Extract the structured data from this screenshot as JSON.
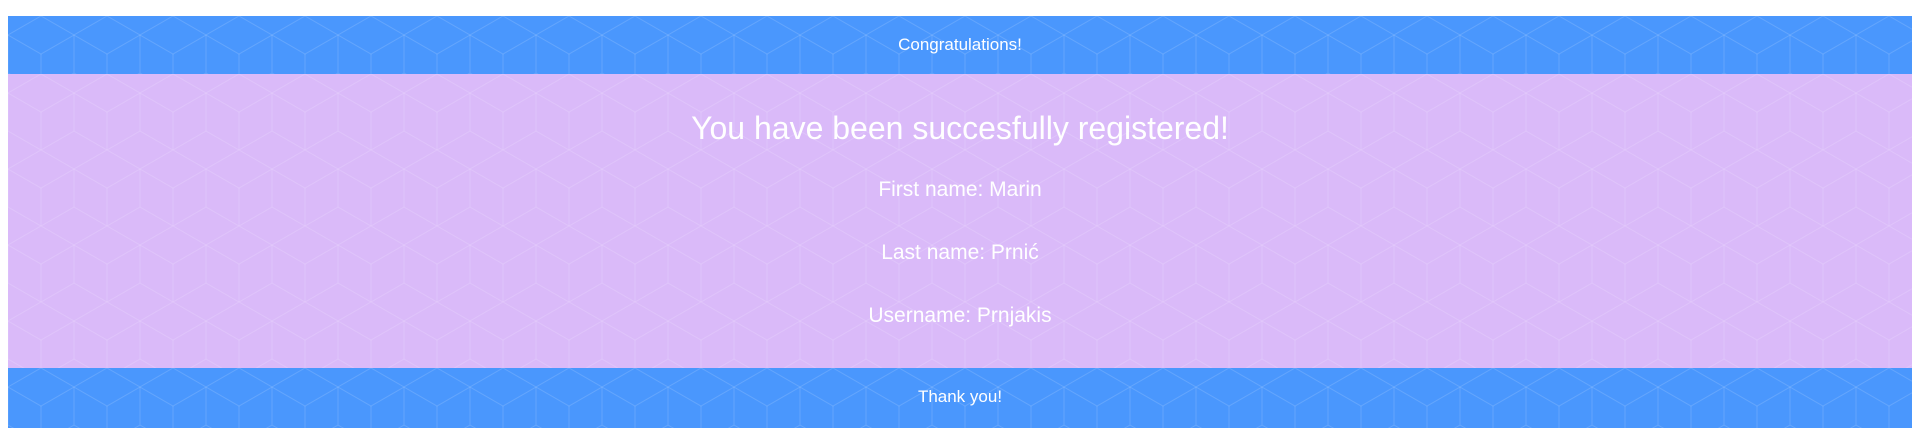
{
  "header": {
    "text": "Congratulations!",
    "color": "#4a97fd"
  },
  "content": {
    "title": "You have been succesfully registered!",
    "first_name": "First name: Marin",
    "last_name": "Last name: Prnić",
    "username": "Username: Prnjakis",
    "color": "#dabaf9"
  },
  "footer": {
    "text": "Thank you!",
    "color": "#4a97fd"
  }
}
